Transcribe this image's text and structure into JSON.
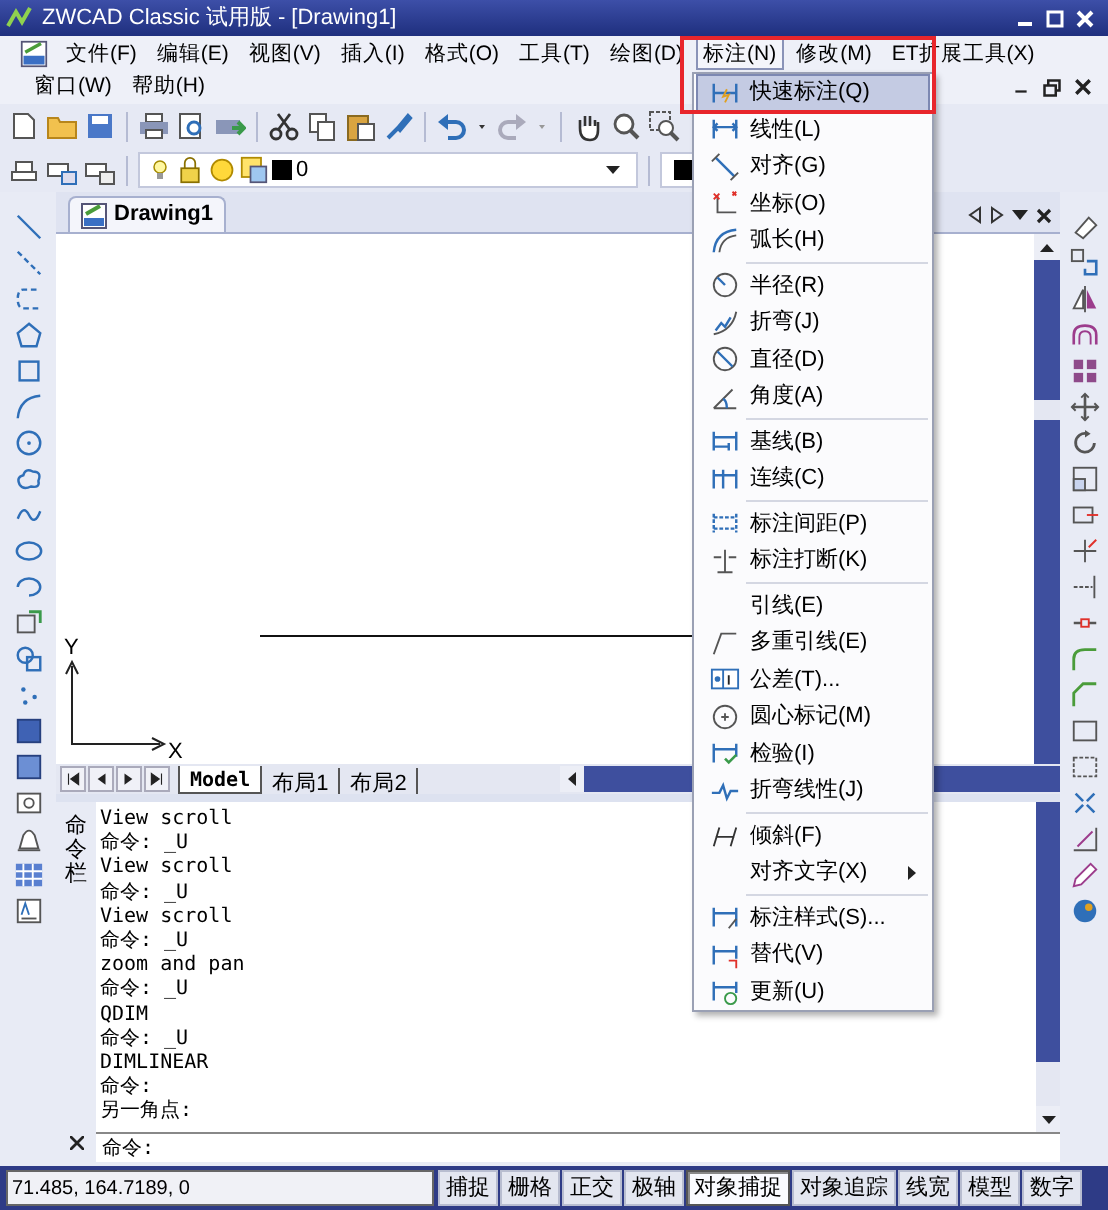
{
  "window": {
    "title": "ZWCAD Classic 试用版 - [Drawing1]"
  },
  "menu_bar": {
    "items": [
      {
        "label": "文件(F)",
        "selected": false
      },
      {
        "label": "编辑(E)",
        "selected": false
      },
      {
        "label": "视图(V)",
        "selected": false
      },
      {
        "label": "插入(I)",
        "selected": false
      },
      {
        "label": "格式(O)",
        "selected": false
      },
      {
        "label": "工具(T)",
        "selected": false
      },
      {
        "label": "绘图(D)",
        "selected": false
      },
      {
        "label": "标注(N)",
        "selected": true
      },
      {
        "label": "修改(M)",
        "selected": false
      },
      {
        "label": "ET扩展工具(X)",
        "selected": false
      }
    ],
    "second_row": [
      "窗口(W)",
      "帮助(H)"
    ]
  },
  "layer_toolbar": {
    "layer": "0"
  },
  "dimension_menu": {
    "items": [
      {
        "kind": "item",
        "label": "快速标注(Q)",
        "selected": true
      },
      {
        "kind": "item",
        "label": "线性(L)",
        "selected": false
      },
      {
        "kind": "item",
        "label": "对齐(G)",
        "selected": false
      },
      {
        "kind": "item",
        "label": "坐标(O)",
        "selected": false
      },
      {
        "kind": "item",
        "label": "弧长(H)",
        "selected": false
      },
      {
        "kind": "separator"
      },
      {
        "kind": "item",
        "label": "半径(R)",
        "selected": false
      },
      {
        "kind": "item",
        "label": "折弯(J)",
        "selected": false
      },
      {
        "kind": "item",
        "label": "直径(D)",
        "selected": false
      },
      {
        "kind": "item",
        "label": "角度(A)",
        "selected": false
      },
      {
        "kind": "separator"
      },
      {
        "kind": "item",
        "label": "基线(B)",
        "selected": false
      },
      {
        "kind": "item",
        "label": "连续(C)",
        "selected": false
      },
      {
        "kind": "separator"
      },
      {
        "kind": "item",
        "label": "标注间距(P)",
        "selected": false
      },
      {
        "kind": "item",
        "label": "标注打断(K)",
        "selected": false
      },
      {
        "kind": "separator"
      },
      {
        "kind": "item",
        "label": "引线(E)",
        "selected": false
      },
      {
        "kind": "item",
        "label": "多重引线(E)",
        "selected": false
      },
      {
        "kind": "item",
        "label": "公差(T)...",
        "selected": false
      },
      {
        "kind": "item",
        "label": "圆心标记(M)",
        "selected": false
      },
      {
        "kind": "item",
        "label": "检验(I)",
        "selected": false
      },
      {
        "kind": "item",
        "label": "折弯线性(J)",
        "selected": false
      },
      {
        "kind": "separator"
      },
      {
        "kind": "item",
        "label": "倾斜(F)",
        "selected": false
      },
      {
        "kind": "submenu",
        "label": "对齐文字(X)",
        "selected": false
      },
      {
        "kind": "separator"
      },
      {
        "kind": "item",
        "label": "标注样式(S)...",
        "selected": false
      },
      {
        "kind": "item",
        "label": "替代(V)",
        "selected": false
      },
      {
        "kind": "item",
        "label": "更新(U)",
        "selected": false
      }
    ]
  },
  "document": {
    "tab": "Drawing1",
    "axis_y": "Y",
    "axis_x": "X"
  },
  "layout_tabs": [
    {
      "label": "Model",
      "selected": true
    },
    {
      "label": "布局1",
      "selected": false
    },
    {
      "label": "布局2",
      "selected": false
    }
  ],
  "command_panel": {
    "title": "命令栏",
    "history": [
      "View scroll",
      "命令: _U",
      "View scroll",
      "命令: _U",
      "View scroll",
      "命令: _U",
      "zoom and pan",
      "命令: _U",
      "QDIM",
      "命令: _U",
      "DIMLINEAR",
      "命令:",
      "另一角点:"
    ],
    "prompt": "命令:"
  },
  "status_bar": {
    "coordinates": "71.485, 164.7189, 0",
    "toggles": [
      {
        "label": "捕捉",
        "on": false
      },
      {
        "label": "栅格",
        "on": false
      },
      {
        "label": "正交",
        "on": false
      },
      {
        "label": "极轴",
        "on": false
      },
      {
        "label": "对象捕捉",
        "on": true
      },
      {
        "label": "对象追踪",
        "on": false
      },
      {
        "label": "线宽",
        "on": false
      },
      {
        "label": "模型",
        "on": false
      },
      {
        "label": "数字",
        "on": false
      }
    ]
  }
}
